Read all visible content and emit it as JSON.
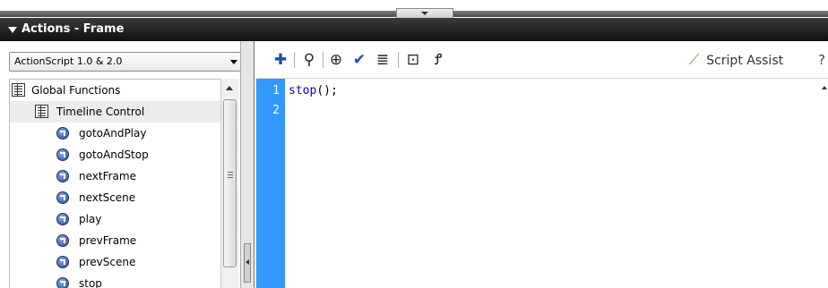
{
  "panel": {
    "title": "Actions - Frame"
  },
  "language_select": {
    "value": "ActionScript 1.0 & 2.0"
  },
  "tree": {
    "items": [
      {
        "label": "Global Functions",
        "icon": "book-icon"
      },
      {
        "label": "Timeline Control",
        "icon": "book-icon"
      },
      {
        "label": "gotoAndPlay",
        "icon": "action-icon"
      },
      {
        "label": "gotoAndStop",
        "icon": "action-icon"
      },
      {
        "label": "nextFrame",
        "icon": "action-icon"
      },
      {
        "label": "nextScene",
        "icon": "action-icon"
      },
      {
        "label": "play",
        "icon": "action-icon"
      },
      {
        "label": "prevFrame",
        "icon": "action-icon"
      },
      {
        "label": "prevScene",
        "icon": "action-icon"
      },
      {
        "label": "stop",
        "icon": "action-icon"
      }
    ]
  },
  "toolbar": {
    "buttons": [
      {
        "name": "add-statement-icon",
        "glyph": "✚"
      },
      {
        "name": "find-icon",
        "glyph": "⚲"
      },
      {
        "name": "insert-target-path-icon",
        "glyph": "⊕"
      },
      {
        "name": "check-syntax-icon",
        "glyph": "✔"
      },
      {
        "name": "auto-format-icon",
        "glyph": "≣"
      },
      {
        "name": "code-hint-icon",
        "glyph": "⊡"
      },
      {
        "name": "debug-options-icon",
        "glyph": "Ꝭ"
      }
    ],
    "script_assist_label": "Script Assist",
    "help_glyph": "?"
  },
  "editor": {
    "line_numbers": [
      "1",
      "2"
    ],
    "lines": [
      {
        "keyword": "stop",
        "rest": "();"
      }
    ]
  },
  "colors": {
    "gutter": "#3399ff",
    "keyword": "#0000cc",
    "title_bg": "#111111"
  }
}
